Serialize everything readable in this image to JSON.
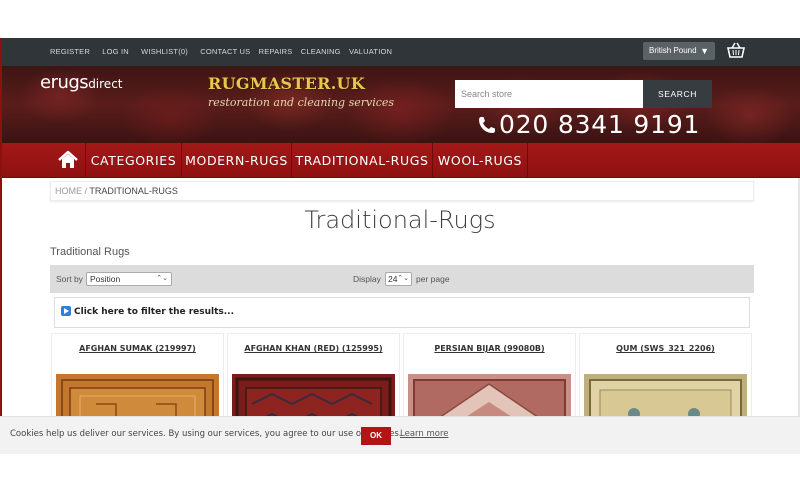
{
  "top_links": [
    "REGISTER",
    "LOG IN",
    "WISHLIST(0)",
    "CONTACT US",
    "REPAIRS",
    "CLEANING",
    "VALUATION"
  ],
  "currency": {
    "selected": "British Pound",
    "caret": "▼"
  },
  "logo": {
    "main": "erugs",
    "suffix": "direct"
  },
  "promo": {
    "title": "RUGMASTER.UK",
    "subtitle": "restoration and cleaning services"
  },
  "search": {
    "placeholder": "Search store",
    "button": "SEARCH"
  },
  "phone": "020 8341 9191",
  "nav": {
    "items": [
      "CATEGORIES",
      "MODERN-RUGS",
      "TRADITIONAL-RUGS",
      "WOOL-RUGS"
    ]
  },
  "breadcrumb": {
    "home": "HOME",
    "separator": "/",
    "current": "TRADITIONAL-RUGS"
  },
  "page_title": "Traditional-Rugs",
  "category_heading": "Traditional Rugs",
  "toolbar": {
    "sort_label": "Sort by",
    "sort_value": "Position",
    "display_label": "Display",
    "display_value": "24",
    "per_page_label": "per page"
  },
  "filter": {
    "text": "Click here to filter the results..."
  },
  "products": [
    {
      "name": "AFGHAN SUMAK (219997)",
      "icon": "rug-image-orange"
    },
    {
      "name": "AFGHAN KHAN (RED) (125995)",
      "icon": "rug-image-red"
    },
    {
      "name": "PERSIAN BIJAR (99080B)",
      "icon": "rug-image-pink"
    },
    {
      "name": "QUM (SWS_321_2206)",
      "icon": "rug-image-beige"
    }
  ],
  "cookie": {
    "text": "Cookies help us deliver our services. By using our services, you agree to our use of cookies.",
    "ok": "OK",
    "more": "Learn more"
  },
  "colors": {
    "nav_red": "#a41818",
    "topbar": "#2f3538",
    "cookie_ok": "#b11515",
    "filter_icon": "#2f7fd6"
  }
}
